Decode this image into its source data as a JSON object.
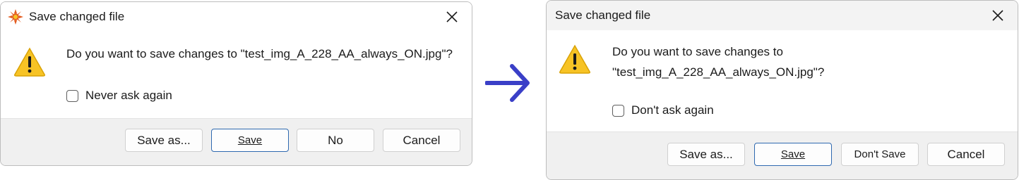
{
  "left_dialog": {
    "title": "Save changed file",
    "message": "Do you want to save changes to \"test_img_A_228_AA_always_ON.jpg\"?",
    "checkbox_label": "Never ask again",
    "buttons": {
      "save_as": "Save as...",
      "save": "Save",
      "no": "No",
      "cancel": "Cancel"
    }
  },
  "right_dialog": {
    "title": "Save changed file",
    "message_line1": "Do you want to save changes to",
    "message_line2": "\"test_img_A_228_AA_always_ON.jpg\"?",
    "checkbox_label": "Don't ask again",
    "buttons": {
      "save_as": "Save as...",
      "save": "Save",
      "dont_save": "Don't Save",
      "cancel": "Cancel"
    }
  },
  "icons": {
    "app": "xnview-app-icon",
    "warning": "warning-icon",
    "close": "close-icon",
    "arrow": "arrow-right-icon"
  },
  "colors": {
    "arrow": "#3a3fc7",
    "warning_fill": "#f7c325",
    "default_button_border": "#2f69b0",
    "footer_bg": "#f0f0f0"
  }
}
